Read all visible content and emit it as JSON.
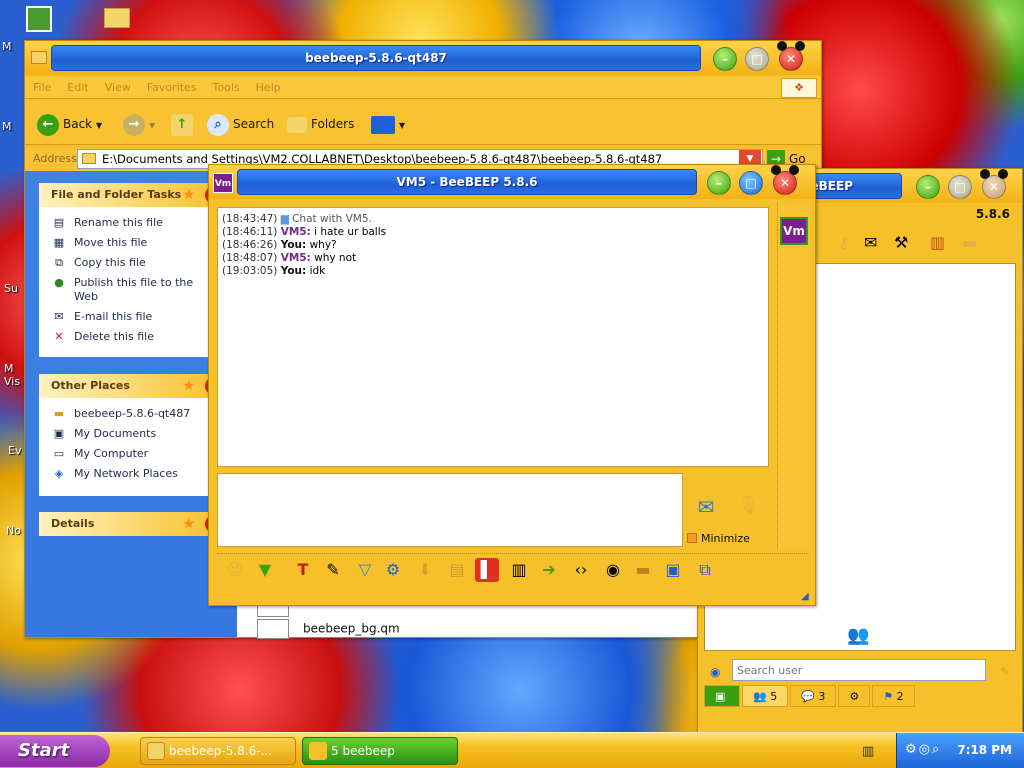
{
  "desktop": {
    "icon_labels": [
      "M",
      "M",
      "Su",
      "M Vis",
      "Ev",
      "No"
    ]
  },
  "explorer": {
    "title": "beebeep-5.8.6-qt487",
    "menu": [
      "File",
      "Edit",
      "View",
      "Favorites",
      "Tools",
      "Help"
    ],
    "toolbar": {
      "back": "Back",
      "search": "Search",
      "folders": "Folders"
    },
    "address": {
      "label": "Address",
      "value": "E:\\Documents and Settings\\VM2.COLLABNET\\Desktop\\beebeep-5.8.6-qt487\\beebeep-5.8.6-qt487",
      "go": "Go"
    },
    "file_tasks": {
      "title": "File and Folder Tasks",
      "items": [
        {
          "label": "Rename this file",
          "icon": "rename-icon"
        },
        {
          "label": "Move this file",
          "icon": "move-icon"
        },
        {
          "label": "Copy this file",
          "icon": "copy-icon"
        },
        {
          "label": "Publish this file to the Web",
          "icon": "globe-icon"
        },
        {
          "label": "E-mail this file",
          "icon": "email-icon"
        },
        {
          "label": "Delete this file",
          "icon": "delete-icon"
        }
      ]
    },
    "other_places": {
      "title": "Other Places",
      "items": [
        {
          "label": "beebeep-5.8.6-qt487",
          "icon": "folder-icon"
        },
        {
          "label": "My Documents",
          "icon": "documents-icon"
        },
        {
          "label": "My Computer",
          "icon": "computer-icon"
        },
        {
          "label": "My Network Places",
          "icon": "network-icon"
        }
      ]
    },
    "details": {
      "title": "Details"
    },
    "files": [
      {
        "name": ""
      },
      {
        "name": "beebeep_bg.qm"
      }
    ]
  },
  "chat": {
    "title": "VM5 - BeeBEEP 5.8.6",
    "app_icon": "Vm",
    "peer_avatar": "Vm",
    "messages": [
      {
        "time": "(18:43:47)",
        "sender": "",
        "text": "Chat with VM5.",
        "kind": "system"
      },
      {
        "time": "(18:46:11)",
        "sender": "VM5:",
        "text": " i hate ur balls",
        "kind": "peer"
      },
      {
        "time": "(18:46:26)",
        "sender": "You:",
        "text": " why?",
        "kind": "you"
      },
      {
        "time": "(18:48:07)",
        "sender": "VM5:",
        "text": " why not",
        "kind": "peer"
      },
      {
        "time": "(19:03:05)",
        "sender": "You:",
        "text": " idk",
        "kind": "you"
      }
    ],
    "input_value": "",
    "minimize_label": "Minimize"
  },
  "beebeep": {
    "title": "eeBEEP",
    "version": "5.8.6",
    "search_placeholder": "Search user",
    "tabs": [
      {
        "count": "5",
        "icon": "users-icon"
      },
      {
        "count": "3",
        "icon": "chats-icon"
      },
      {
        "count": "",
        "icon": "groups-icon"
      },
      {
        "count": "2",
        "icon": "shares-icon"
      }
    ]
  },
  "taskbar": {
    "start": "Start",
    "tasks": [
      {
        "label": "beebeep-5.8.6-...",
        "active": false
      },
      {
        "label": "5 beebeep",
        "active": true
      }
    ],
    "clock": "7:18 PM"
  },
  "colors": {
    "chrome_yellow": "#f6c02a",
    "title_blue": "#1f5fd6",
    "peer_purple": "#6b2d8a",
    "task_pane_blue": "#3478e0"
  }
}
